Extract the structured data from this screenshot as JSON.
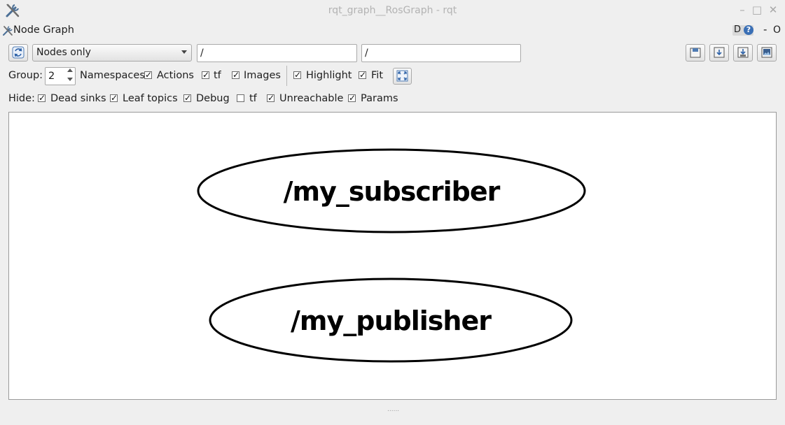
{
  "window": {
    "title": "rqt_graph__RosGraph - rqt"
  },
  "plugin": {
    "title": "Node Graph",
    "help_letter": "D",
    "help_icon": "?",
    "minimize_glyph": "-",
    "close_glyph": "O"
  },
  "toolbar": {
    "mode_select": {
      "selected": "Nodes only"
    },
    "namespace_filter": {
      "value": "/"
    },
    "topic_filter": {
      "value": "/"
    }
  },
  "options": {
    "group_label": "Group:",
    "group_value": "2",
    "checkboxes": [
      {
        "label": "Namespaces",
        "checked": false
      },
      {
        "label": "Actions",
        "checked": true
      },
      {
        "label": "tf",
        "checked": true
      },
      {
        "label": "Images",
        "checked": true
      },
      {
        "label": "Highlight",
        "checked": true
      },
      {
        "label": "Fit",
        "checked": true
      }
    ]
  },
  "hide": {
    "label": "Hide:",
    "checkboxes": [
      {
        "label": "Dead sinks",
        "checked": true
      },
      {
        "label": "Leaf topics",
        "checked": true
      },
      {
        "label": "Debug",
        "checked": true
      },
      {
        "label": "tf",
        "checked": false
      },
      {
        "label": "Unreachable",
        "checked": true
      },
      {
        "label": "Params",
        "checked": true
      }
    ]
  },
  "graph": {
    "nodes": [
      {
        "label": "/my_subscriber"
      },
      {
        "label": "/my_publisher"
      }
    ]
  },
  "check_glyph": "✓",
  "splitter_glyph": "......"
}
